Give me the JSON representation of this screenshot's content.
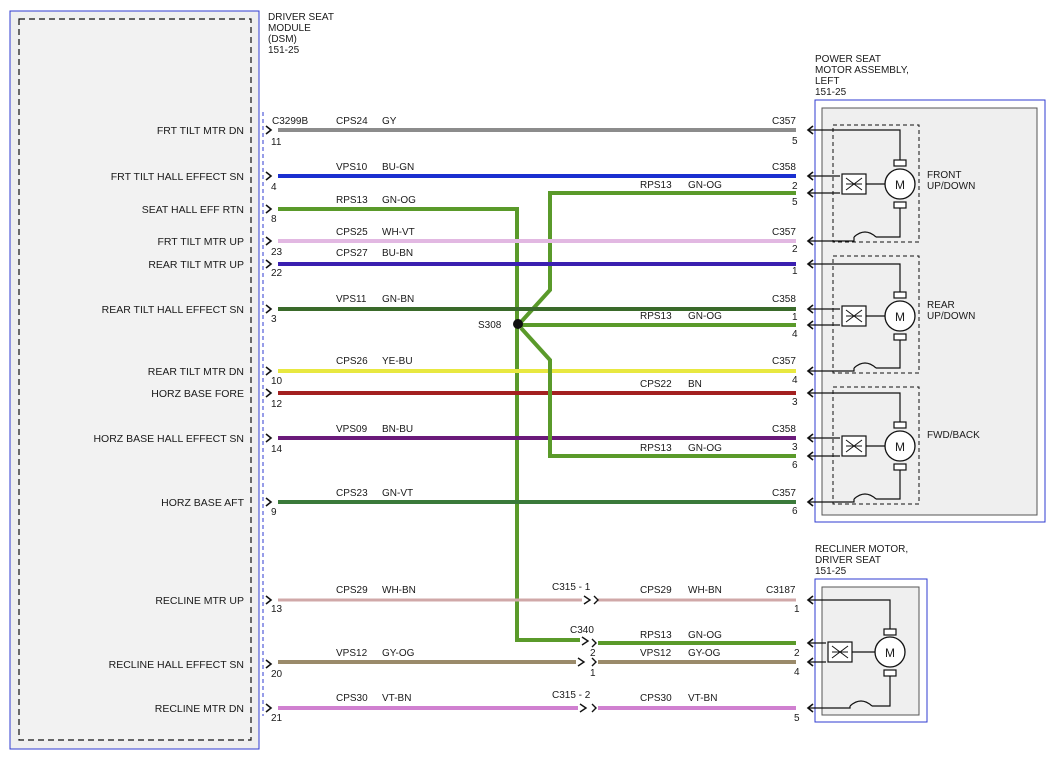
{
  "modules": {
    "dsm": {
      "title_lines": [
        "DRIVER SEAT",
        "MODULE",
        "(DSM)",
        "151-25"
      ],
      "connector": "C3299B",
      "pins": [
        {
          "label": "FRT TILT MTR DN",
          "pin": "11"
        },
        {
          "label": "FRT TILT HALL EFFECT SN",
          "pin": "4"
        },
        {
          "label": "SEAT HALL EFF RTN",
          "pin": "8"
        },
        {
          "label": "FRT TILT MTR UP",
          "pin": "23"
        },
        {
          "label": "REAR TILT MTR UP",
          "pin": "22"
        },
        {
          "label": "REAR TILT HALL EFFECT SN",
          "pin": "3"
        },
        {
          "label": "REAR TILT MTR DN",
          "pin": "10"
        },
        {
          "label": "HORZ BASE FORE",
          "pin": "12"
        },
        {
          "label": "HORZ BASE HALL EFFECT SN",
          "pin": "14"
        },
        {
          "label": "HORZ BASE AFT",
          "pin": "9"
        },
        {
          "label": "RECLINE MTR UP",
          "pin": "13"
        },
        {
          "label": "RECLINE HALL EFFECT SN",
          "pin": "20"
        },
        {
          "label": "RECLINE MTR DN",
          "pin": "21"
        }
      ]
    },
    "power_seat": {
      "title_lines": [
        "POWER SEAT",
        "MOTOR ASSEMBLY,",
        "LEFT",
        "151-25"
      ],
      "motors": [
        {
          "label_lines": [
            "FRONT",
            "UP/DOWN"
          ],
          "symbol": "M"
        },
        {
          "label_lines": [
            "REAR",
            "UP/DOWN"
          ],
          "symbol": "M"
        },
        {
          "label_lines": [
            "FWD/BACK"
          ],
          "symbol": "M"
        }
      ]
    },
    "recliner": {
      "title_lines": [
        "RECLINER MOTOR,",
        "DRIVER SEAT",
        "151-25"
      ],
      "motor_symbol": "M"
    }
  },
  "wires": [
    {
      "circuit": "CPS24",
      "color": "GY",
      "hex": "#8c8c8c",
      "connector": "C357",
      "pin": "5"
    },
    {
      "circuit": "VPS10",
      "color": "BU-GN",
      "hex": "#1a2fd0",
      "connector": "C358",
      "pin": "2"
    },
    {
      "circuit": "RPS13",
      "color": "GN-OG",
      "hex": "#5a9a2a"
    },
    {
      "circuit": "RPS13",
      "color": "GN-OG",
      "hex": "#5a9a2a",
      "pin_top": "2",
      "pin_bottom": "5"
    },
    {
      "circuit": "CPS25",
      "color": "WH-VT",
      "hex": "#e2b8e2",
      "connector": "C357",
      "pin": "2"
    },
    {
      "circuit": "CPS27",
      "color": "BU-BN",
      "hex": "#3a1fb0",
      "pin": "1"
    },
    {
      "circuit": "VPS11",
      "color": "GN-BN",
      "hex": "#3a6a2a",
      "connector": "C358",
      "pin": "1"
    },
    {
      "circuit": "RPS13",
      "color": "GN-OG",
      "hex": "#5a9a2a",
      "pin": "4"
    },
    {
      "circuit": "CPS26",
      "color": "YE-BU",
      "hex": "#e8e840",
      "connector": "C357",
      "pin": "4"
    },
    {
      "circuit": "CPS22",
      "color": "BN",
      "hex": "#a32020",
      "pin": "3"
    },
    {
      "circuit": "VPS09",
      "color": "BN-BU",
      "hex": "#6a1a7a",
      "connector": "C358",
      "pin": "3"
    },
    {
      "circuit": "RPS13",
      "color": "GN-OG",
      "hex": "#5a9a2a",
      "pin": "6"
    },
    {
      "circuit": "CPS23",
      "color": "GN-VT",
      "hex": "#3a7a3a",
      "connector": "C357",
      "pin": "6"
    },
    {
      "circuit": "CPS29",
      "color": "WH-BN",
      "hex": "#d0a8a8",
      "inline": "C315 - 1",
      "connector": "C3187",
      "pin": "1"
    },
    {
      "circuit": "RPS13",
      "color": "GN-OG",
      "hex": "#5a9a2a",
      "inline": "C340",
      "inline_pin": "2",
      "pin": "2"
    },
    {
      "circuit": "VPS12",
      "color": "GY-OG",
      "hex": "#9a8a6a",
      "inline_pin": "1",
      "pin": "4"
    },
    {
      "circuit": "CPS30",
      "color": "VT-BN",
      "hex": "#d080d0",
      "inline": "C315 - 2",
      "pin": "5"
    }
  ],
  "splice": {
    "name": "S308"
  }
}
